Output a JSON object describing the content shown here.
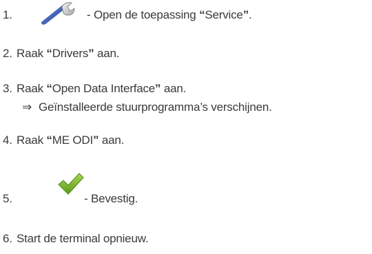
{
  "steps": [
    {
      "number": "1.",
      "prefix": " - Open de toepassing ",
      "q_open": "“",
      "term": "Service",
      "q_close": "”",
      "suffix": ".",
      "icon": "wrench-icon"
    },
    {
      "number": "2.",
      "prefix": "Raak ",
      "q_open": "“",
      "term": "Drivers",
      "q_close": "”",
      "suffix": " aan."
    },
    {
      "number": "3.",
      "prefix": "Raak ",
      "q_open": "“",
      "term": "Open Data Interface",
      "q_close": "”",
      "suffix": " aan.",
      "result_arrow": "⇒",
      "result_text": "Geïnstalleerde stuurprogramma’s verschijnen."
    },
    {
      "number": "4.",
      "prefix": "Raak ",
      "q_open": "“",
      "term": "ME ODI",
      "q_close": "”",
      "suffix": " aan."
    },
    {
      "number": "5.",
      "text": " - Bevestig.",
      "icon": "checkmark-icon"
    },
    {
      "number": "6.",
      "text": "Start de terminal opnieuw."
    }
  ],
  "colors": {
    "text": "#3a3a3a",
    "wrench_blue": "#2a4fa6",
    "check_green": "#7cb52a"
  }
}
